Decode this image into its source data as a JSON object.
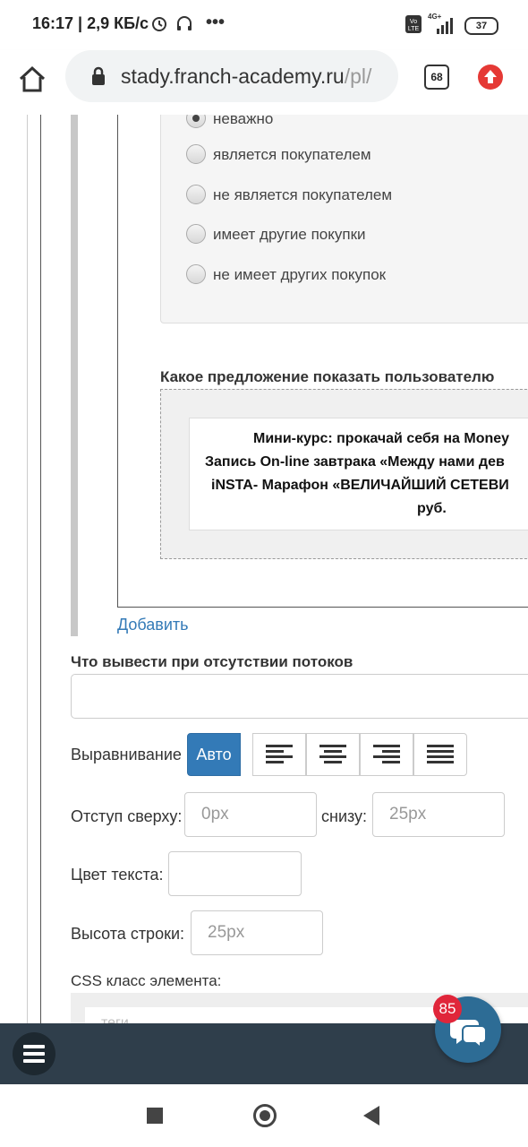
{
  "status_bar": {
    "time_info": "16:17 | 2,9 КБ/с",
    "network": "4G+",
    "battery": "37"
  },
  "browser": {
    "url_main": "stady.franch-academy.ru",
    "url_dim": "/pl/",
    "tab_count": "68"
  },
  "form": {
    "radio_options": [
      {
        "label": "неважно",
        "checked": true
      },
      {
        "label": "является покупателем",
        "checked": false
      },
      {
        "label": "не является покупателем",
        "checked": false
      },
      {
        "label": "имеет другие покупки",
        "checked": false
      },
      {
        "label": "не имеет других покупок",
        "checked": false
      }
    ],
    "offer_label": "Какое предложение показать пользователю",
    "offer_lines": [
      "Мини-курс: прокачай себя на Money",
      "Запись On-line завтрака «Между нами дев",
      "iNSTA- Марафон «ВЕЛИЧАЙШИЙ СЕТЕВИ",
      "руб."
    ],
    "add_link": "Добавить",
    "no_flows_label": "Что вывести при отсутствии потоков",
    "no_flows_value": "",
    "align_label": "Выравнивание",
    "align_auto": "Авто",
    "top_offset_label": "Отступ сверху:",
    "top_offset_placeholder": "0px",
    "bottom_offset_label": "снизу:",
    "bottom_offset_placeholder": "25px",
    "text_color_label": "Цвет текста:",
    "line_height_label": "Высота строки:",
    "line_height_placeholder": "25px",
    "css_class_label": "CSS класс элемента:",
    "css_class_value": "теги"
  },
  "chat": {
    "badge_count": "85"
  },
  "colors": {
    "accent": "#337ab7",
    "bottom_bar": "#2f3e4b",
    "chat_button": "#2d6c95",
    "badge": "#e0263a"
  }
}
